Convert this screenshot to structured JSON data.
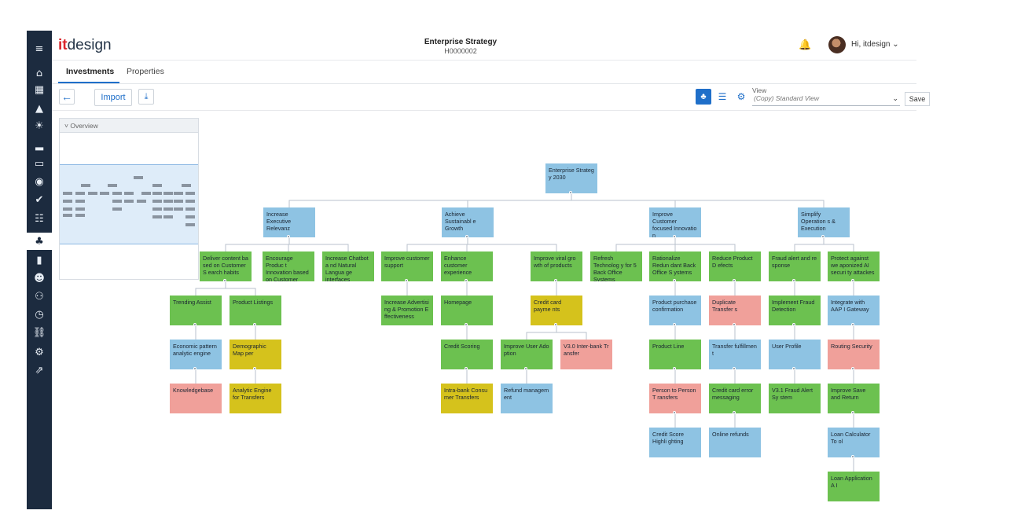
{
  "app": {
    "logo_it": "it",
    "logo_design": "design",
    "title": "Enterprise Strategy",
    "subtitle": "H0000002",
    "greeting": "Hi, itdesign"
  },
  "tabs": [
    "Investments",
    "Properties"
  ],
  "toolbar": {
    "back_icon": "arrow-left",
    "import_label": "Import",
    "download_icon": "download",
    "view_label": "View",
    "view_value": "(Copy) Standard View",
    "save_label": "Save"
  },
  "overview": {
    "label": "Overview"
  },
  "sidebar_icons": [
    "menu-icon",
    "home-icon",
    "dashboard-icon",
    "chart-area-icon",
    "idea-icon",
    "bar-chart-icon",
    "presentation-icon",
    "database-icon",
    "check-icon",
    "list-check-icon",
    "hierarchy-icon",
    "map-icon",
    "team-icon",
    "brain-icon",
    "clock-icon",
    "link-icon",
    "settings-users-icon",
    "export-icon"
  ],
  "nodes": [
    {
      "id": "root",
      "text": "Enterprise Strateg y 2030",
      "color": "blue"
    },
    {
      "id": "a",
      "text": "Increase Executive Relevanz",
      "color": "blue"
    },
    {
      "id": "b",
      "text": "Achieve Sustainabl e Growth",
      "color": "blue"
    },
    {
      "id": "c",
      "text": "Improve Customer focused Innovatio n",
      "color": "blue"
    },
    {
      "id": "d",
      "text": "Simplify Operation s & Execution",
      "color": "blue"
    },
    {
      "id": "a1",
      "text": "Deliver content ba sed on Customer S earch habits",
      "color": "green"
    },
    {
      "id": "a2",
      "text": "Encourage Produc t Innovation based on Customer Fee...",
      "color": "green"
    },
    {
      "id": "a3",
      "text": "Increase Chatbot a nd Natural Langua ge interfaces",
      "color": "green"
    },
    {
      "id": "b1",
      "text": "Improve customer support",
      "color": "green"
    },
    {
      "id": "b2",
      "text": "Enhance customer experience",
      "color": "green"
    },
    {
      "id": "b3",
      "text": "Improve viral gro wth of products",
      "color": "green"
    },
    {
      "id": "c1",
      "text": "Refresh Technolog y for 5 Back Office Systems",
      "color": "green"
    },
    {
      "id": "c2",
      "text": "Rationalize Redun dant Back Office S ystems",
      "color": "green"
    },
    {
      "id": "c3",
      "text": "Reduce Product D efects",
      "color": "green"
    },
    {
      "id": "d1",
      "text": "Fraud alert and re sponse",
      "color": "green"
    },
    {
      "id": "d2",
      "text": "Protect against we aponized AI securi ty attackes",
      "color": "green"
    },
    {
      "id": "a1a",
      "text": "Trending Assist",
      "color": "green"
    },
    {
      "id": "a1b",
      "text": "Product Listings",
      "color": "green"
    },
    {
      "id": "a1a1",
      "text": "Economic pattern analytic engine",
      "color": "blue"
    },
    {
      "id": "a1a2",
      "text": "Knowledgebase",
      "color": "red"
    },
    {
      "id": "a1b1",
      "text": "Demographic Map per",
      "color": "yellow"
    },
    {
      "id": "a1b2",
      "text": "Analytic Engine for Transfers",
      "color": "yellow"
    },
    {
      "id": "b1a",
      "text": "Increase Advertisi ng & Promotion E ffectiveness",
      "color": "green"
    },
    {
      "id": "b2a",
      "text": "Homepage",
      "color": "green"
    },
    {
      "id": "b2b",
      "text": "Credit Scoring",
      "color": "green"
    },
    {
      "id": "b2c",
      "text": "Intra-bank Consu mer Transfers",
      "color": "yellow"
    },
    {
      "id": "b3a",
      "text": "Credit card payme nts",
      "color": "yellow"
    },
    {
      "id": "b3a1",
      "text": "Improve User Ado ption",
      "color": "green"
    },
    {
      "id": "b3a2",
      "text": "V3.0 Inter-bank Tr ansfer",
      "color": "red"
    },
    {
      "id": "b3a1a",
      "text": "Refund managem ent",
      "color": "blue"
    },
    {
      "id": "c2a",
      "text": "Product purchase confirmation",
      "color": "blue"
    },
    {
      "id": "c2b",
      "text": "Product Line",
      "color": "green"
    },
    {
      "id": "c2c",
      "text": "Person to Person T ransfers",
      "color": "red"
    },
    {
      "id": "c2d",
      "text": "Credit Score Highli ghting",
      "color": "blue"
    },
    {
      "id": "c3a",
      "text": "Duplicate Transfer s",
      "color": "red"
    },
    {
      "id": "c3b",
      "text": "Transfer fulfillmen t",
      "color": "blue"
    },
    {
      "id": "c3c",
      "text": "Credit card error messaging",
      "color": "green"
    },
    {
      "id": "c3d",
      "text": "Online refunds",
      "color": "blue"
    },
    {
      "id": "d1a",
      "text": "Implement Fraud Detection",
      "color": "green"
    },
    {
      "id": "d1b",
      "text": "User Profile",
      "color": "blue"
    },
    {
      "id": "d1c",
      "text": "V3.1 Fraud Alert Sy stem",
      "color": "green"
    },
    {
      "id": "d2a",
      "text": "Integrate with AAP I Gateway",
      "color": "blue"
    },
    {
      "id": "d2b",
      "text": "Routing Security",
      "color": "red"
    },
    {
      "id": "d2c",
      "text": "Improve Save and Return",
      "color": "green"
    },
    {
      "id": "d2d",
      "text": "Loan Calculator To ol",
      "color": "blue"
    },
    {
      "id": "d2e",
      "text": "Loan Application A I",
      "color": "green"
    }
  ],
  "colors": {
    "blue": "#8ec3e3",
    "green": "#6cc150",
    "yellow": "#d5c21c",
    "red": "#f0a09a",
    "sidebar": "#1c2b3f",
    "accent": "#1f6fc9"
  }
}
